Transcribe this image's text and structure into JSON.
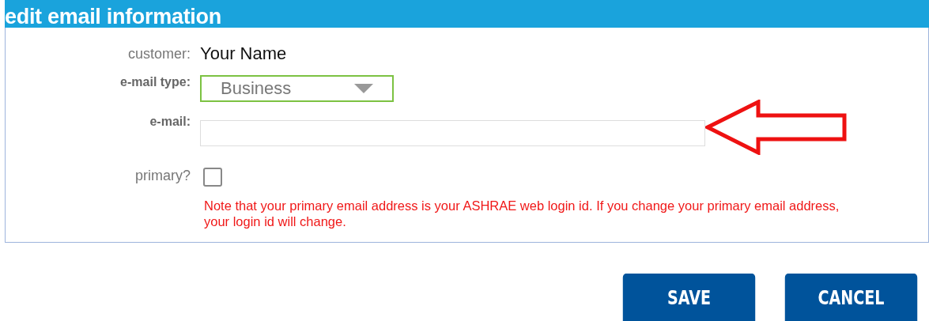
{
  "panel": {
    "title": "edit email information"
  },
  "fields": [
    {
      "kind": "text",
      "label": "customer:",
      "value": "Your Name"
    },
    {
      "kind": "select",
      "label": "e-mail type:",
      "value": "Business"
    },
    {
      "kind": "input",
      "label": "e-mail:"
    },
    {
      "kind": "checkbox",
      "label": "primary?",
      "checked": false,
      "note": "Note that your primary email address is your ASHRAE web login id. If you change your primary email address, your login id will change."
    }
  ],
  "buttons": [
    "SAVE",
    "CANCEL"
  ]
}
